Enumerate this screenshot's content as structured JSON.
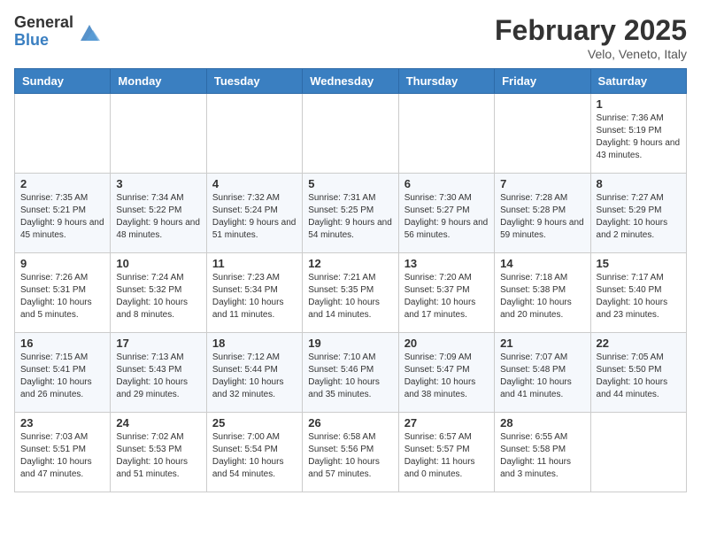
{
  "header": {
    "logo_general": "General",
    "logo_blue": "Blue",
    "month_title": "February 2025",
    "location": "Velo, Veneto, Italy"
  },
  "weekdays": [
    "Sunday",
    "Monday",
    "Tuesday",
    "Wednesday",
    "Thursday",
    "Friday",
    "Saturday"
  ],
  "weeks": [
    [
      {
        "day": "",
        "info": ""
      },
      {
        "day": "",
        "info": ""
      },
      {
        "day": "",
        "info": ""
      },
      {
        "day": "",
        "info": ""
      },
      {
        "day": "",
        "info": ""
      },
      {
        "day": "",
        "info": ""
      },
      {
        "day": "1",
        "info": "Sunrise: 7:36 AM\nSunset: 5:19 PM\nDaylight: 9 hours and 43 minutes."
      }
    ],
    [
      {
        "day": "2",
        "info": "Sunrise: 7:35 AM\nSunset: 5:21 PM\nDaylight: 9 hours and 45 minutes."
      },
      {
        "day": "3",
        "info": "Sunrise: 7:34 AM\nSunset: 5:22 PM\nDaylight: 9 hours and 48 minutes."
      },
      {
        "day": "4",
        "info": "Sunrise: 7:32 AM\nSunset: 5:24 PM\nDaylight: 9 hours and 51 minutes."
      },
      {
        "day": "5",
        "info": "Sunrise: 7:31 AM\nSunset: 5:25 PM\nDaylight: 9 hours and 54 minutes."
      },
      {
        "day": "6",
        "info": "Sunrise: 7:30 AM\nSunset: 5:27 PM\nDaylight: 9 hours and 56 minutes."
      },
      {
        "day": "7",
        "info": "Sunrise: 7:28 AM\nSunset: 5:28 PM\nDaylight: 9 hours and 59 minutes."
      },
      {
        "day": "8",
        "info": "Sunrise: 7:27 AM\nSunset: 5:29 PM\nDaylight: 10 hours and 2 minutes."
      }
    ],
    [
      {
        "day": "9",
        "info": "Sunrise: 7:26 AM\nSunset: 5:31 PM\nDaylight: 10 hours and 5 minutes."
      },
      {
        "day": "10",
        "info": "Sunrise: 7:24 AM\nSunset: 5:32 PM\nDaylight: 10 hours and 8 minutes."
      },
      {
        "day": "11",
        "info": "Sunrise: 7:23 AM\nSunset: 5:34 PM\nDaylight: 10 hours and 11 minutes."
      },
      {
        "day": "12",
        "info": "Sunrise: 7:21 AM\nSunset: 5:35 PM\nDaylight: 10 hours and 14 minutes."
      },
      {
        "day": "13",
        "info": "Sunrise: 7:20 AM\nSunset: 5:37 PM\nDaylight: 10 hours and 17 minutes."
      },
      {
        "day": "14",
        "info": "Sunrise: 7:18 AM\nSunset: 5:38 PM\nDaylight: 10 hours and 20 minutes."
      },
      {
        "day": "15",
        "info": "Sunrise: 7:17 AM\nSunset: 5:40 PM\nDaylight: 10 hours and 23 minutes."
      }
    ],
    [
      {
        "day": "16",
        "info": "Sunrise: 7:15 AM\nSunset: 5:41 PM\nDaylight: 10 hours and 26 minutes."
      },
      {
        "day": "17",
        "info": "Sunrise: 7:13 AM\nSunset: 5:43 PM\nDaylight: 10 hours and 29 minutes."
      },
      {
        "day": "18",
        "info": "Sunrise: 7:12 AM\nSunset: 5:44 PM\nDaylight: 10 hours and 32 minutes."
      },
      {
        "day": "19",
        "info": "Sunrise: 7:10 AM\nSunset: 5:46 PM\nDaylight: 10 hours and 35 minutes."
      },
      {
        "day": "20",
        "info": "Sunrise: 7:09 AM\nSunset: 5:47 PM\nDaylight: 10 hours and 38 minutes."
      },
      {
        "day": "21",
        "info": "Sunrise: 7:07 AM\nSunset: 5:48 PM\nDaylight: 10 hours and 41 minutes."
      },
      {
        "day": "22",
        "info": "Sunrise: 7:05 AM\nSunset: 5:50 PM\nDaylight: 10 hours and 44 minutes."
      }
    ],
    [
      {
        "day": "23",
        "info": "Sunrise: 7:03 AM\nSunset: 5:51 PM\nDaylight: 10 hours and 47 minutes."
      },
      {
        "day": "24",
        "info": "Sunrise: 7:02 AM\nSunset: 5:53 PM\nDaylight: 10 hours and 51 minutes."
      },
      {
        "day": "25",
        "info": "Sunrise: 7:00 AM\nSunset: 5:54 PM\nDaylight: 10 hours and 54 minutes."
      },
      {
        "day": "26",
        "info": "Sunrise: 6:58 AM\nSunset: 5:56 PM\nDaylight: 10 hours and 57 minutes."
      },
      {
        "day": "27",
        "info": "Sunrise: 6:57 AM\nSunset: 5:57 PM\nDaylight: 11 hours and 0 minutes."
      },
      {
        "day": "28",
        "info": "Sunrise: 6:55 AM\nSunset: 5:58 PM\nDaylight: 11 hours and 3 minutes."
      },
      {
        "day": "",
        "info": ""
      }
    ]
  ]
}
